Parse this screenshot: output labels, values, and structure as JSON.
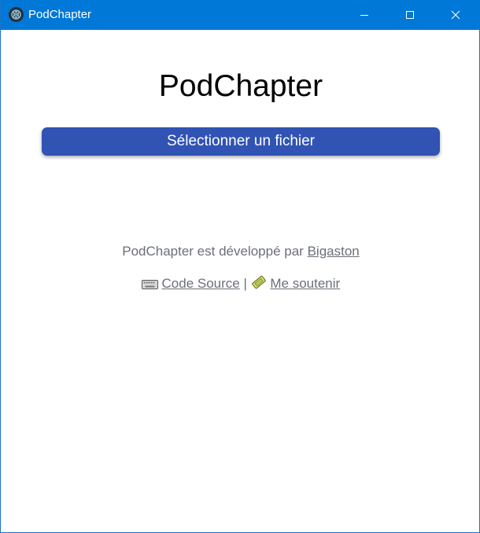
{
  "window": {
    "title": "PodChapter",
    "controls": {
      "minimize": "minimize",
      "maximize": "maximize",
      "close": "close"
    },
    "titlebar_color": "#0078d7"
  },
  "main": {
    "app_title": "PodChapter",
    "select_button_label": "Sélectionner un fichier",
    "button_color": "#3053b4",
    "credits": {
      "prefix": "PodChapter est développé par",
      "author_link": "Bigaston"
    },
    "links": {
      "source_label": "Code Source",
      "separator": "|",
      "support_label": "Me soutenir",
      "source_icon": "keyboard-icon",
      "support_icon": "ticket-icon"
    }
  }
}
